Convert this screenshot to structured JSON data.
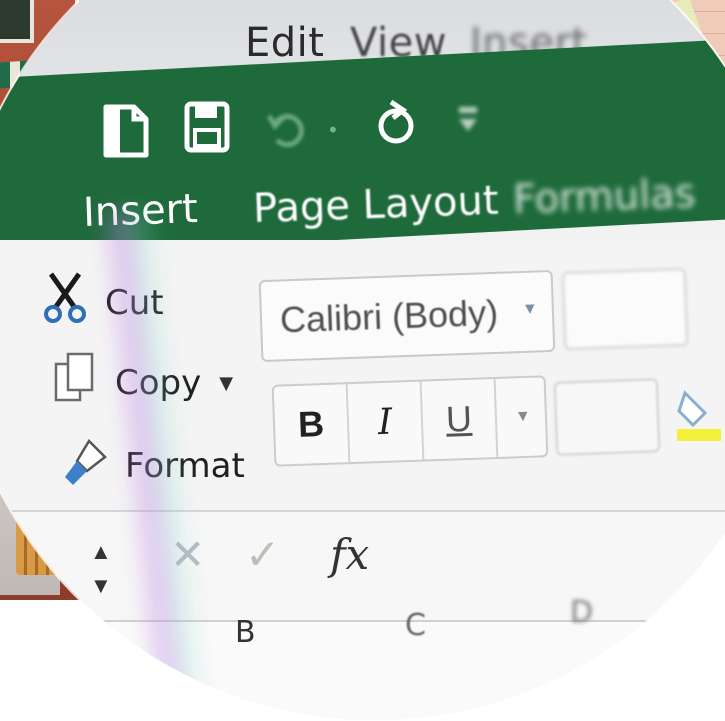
{
  "menu": {
    "items": [
      "Edit",
      "View",
      "Insert"
    ]
  },
  "ribbon": {
    "tabs": [
      "Insert",
      "Page Layout",
      "Formulas"
    ],
    "quick_access_icons": [
      "new-document-icon",
      "save-icon",
      "undo-icon",
      "redo-icon",
      "more-icon"
    ],
    "accent_color": "#1e6a3b"
  },
  "clipboard": {
    "cut_label": "Cut",
    "copy_label": "Copy",
    "format_label": "Format"
  },
  "font": {
    "family": "Calibri (Body)",
    "bold_label": "B",
    "italic_label": "I",
    "underline_label": "U"
  },
  "formula_bar": {
    "fx_label": "fx"
  },
  "grid": {
    "columns": [
      "B",
      "C",
      "D"
    ]
  }
}
